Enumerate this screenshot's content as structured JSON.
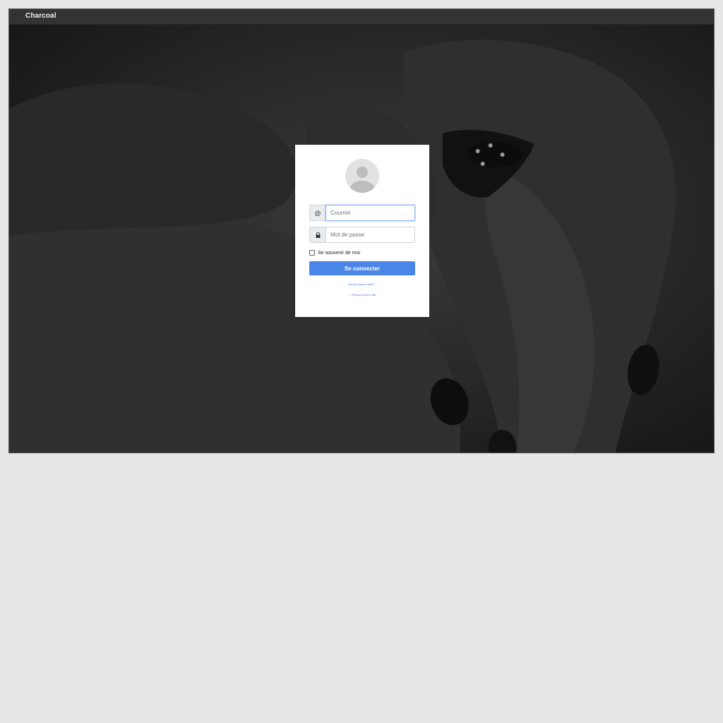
{
  "app": {
    "brand": "Charcoal"
  },
  "login": {
    "email_addon": "@",
    "email_placeholder": "Courriel",
    "password_placeholder": "Mot de passe",
    "remember_label": "Se souvenir de moi",
    "submit_label": "Se connecter",
    "forgot_link": "Mot de passe oublié ?",
    "back_link": "← Retours vers le site"
  },
  "colors": {
    "accent": "#4a86e8",
    "topbar": "#333333",
    "page_background": "#e7e7e7"
  },
  "icons": {
    "password_addon": "lock-icon",
    "avatar": "user-avatar-icon"
  }
}
